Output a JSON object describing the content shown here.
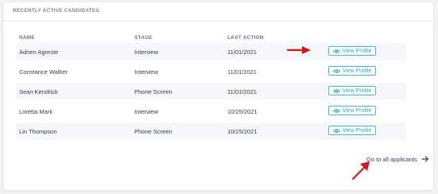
{
  "panel": {
    "title": "RECENTLY ACTIVE CANDIDATES"
  },
  "table": {
    "headers": [
      "NAME",
      "STAGE",
      "LAST ACTION"
    ],
    "rows": [
      {
        "name": "Adrien Agreste",
        "stage": "Interview",
        "last_action": "11/01/2021",
        "action_label": "View Profile"
      },
      {
        "name": "Constance Walker",
        "stage": "Interview",
        "last_action": "11/01/2021",
        "action_label": "View Profile"
      },
      {
        "name": "Sean Kendrick",
        "stage": "Phone Screen",
        "last_action": "11/01/2021",
        "action_label": "View Profile"
      },
      {
        "name": "Loretta Mark",
        "stage": "Interview",
        "last_action": "10/25/2021",
        "action_label": "View Profile"
      },
      {
        "name": "Lin Thompson",
        "stage": "Phone Screen",
        "last_action": "10/25/2021",
        "action_label": "View Profile"
      }
    ]
  },
  "footer": {
    "link_label": "Go to all applicants"
  },
  "colors": {
    "accent": "#2aa6b4",
    "annotation": "#d7141a",
    "link": "#2f3d66"
  },
  "icons": {
    "view": "eye-icon",
    "link_arrow": "arrow-right-icon",
    "annotation": "red-arrow-annotation"
  }
}
